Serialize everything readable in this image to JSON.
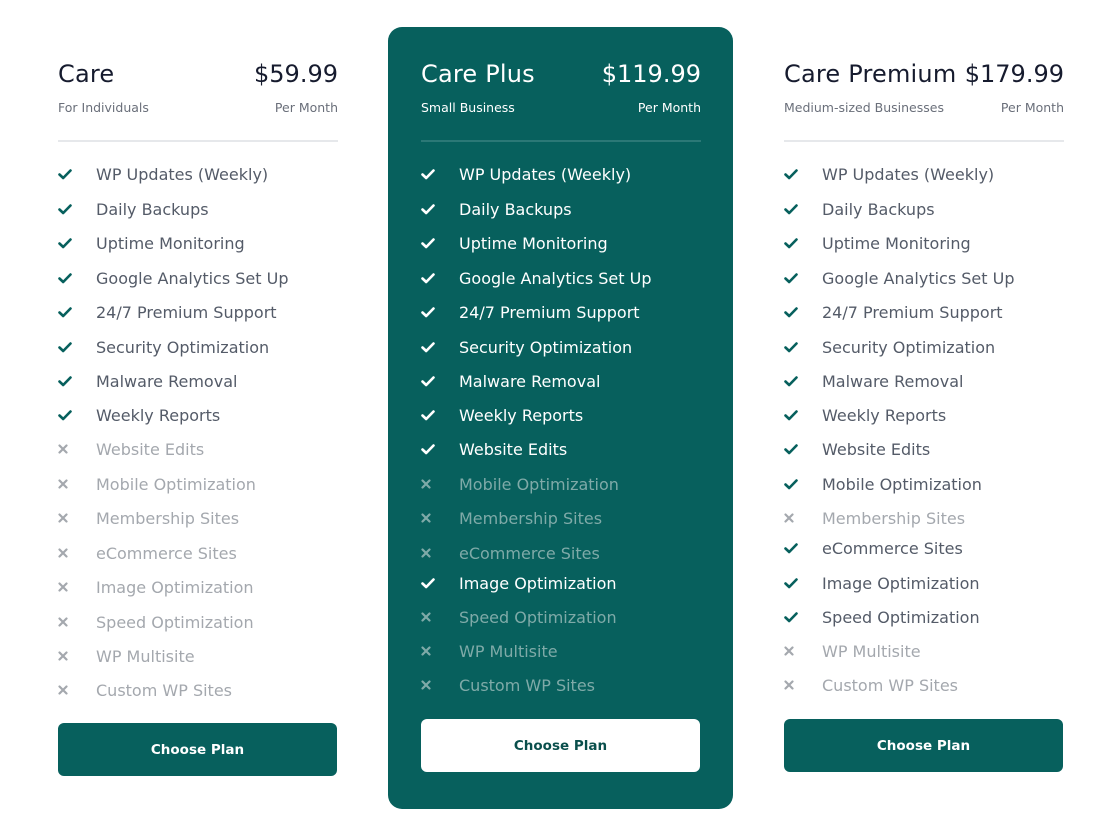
{
  "colors": {
    "brand": "#07605D",
    "text_dark": "#161B2E",
    "text_muted": "#6A6F7A",
    "feature_on": "#545B68",
    "feature_off": "#A4A8AE"
  },
  "plans": [
    {
      "title": "Care",
      "price": "$59.99",
      "audience": "For Individuals",
      "period": "Per Month",
      "cta": "Choose Plan",
      "features": [
        {
          "label": "WP Updates (Weekly)",
          "included": true,
          "icon": "check-icon"
        },
        {
          "label": "Daily Backups",
          "included": true,
          "icon": "check-icon"
        },
        {
          "label": "Uptime Monitoring",
          "included": true,
          "icon": "check-icon"
        },
        {
          "label": "Google Analytics Set Up",
          "included": true,
          "icon": "check-icon"
        },
        {
          "label": "24/7 Premium Support",
          "included": true,
          "icon": "check-icon"
        },
        {
          "label": "Security Optimization",
          "included": true,
          "icon": "check-icon"
        },
        {
          "label": "Malware Removal",
          "included": true,
          "icon": "check-icon"
        },
        {
          "label": "Weekly Reports",
          "included": true,
          "icon": "check-icon"
        },
        {
          "label": "Website Edits",
          "included": false,
          "icon": "x-icon"
        },
        {
          "label": "Mobile Optimization",
          "included": false,
          "icon": "x-icon"
        },
        {
          "label": "Membership Sites",
          "included": false,
          "icon": "x-icon"
        },
        {
          "label": "eCommerce Sites",
          "included": false,
          "icon": "x-icon"
        },
        {
          "label": "Image Optimization",
          "included": false,
          "icon": "x-icon"
        },
        {
          "label": "Speed Optimization",
          "included": false,
          "icon": "x-icon"
        },
        {
          "label": "WP Multisite",
          "included": false,
          "icon": "x-icon"
        },
        {
          "label": "Custom WP Sites",
          "included": false,
          "icon": "x-icon"
        }
      ]
    },
    {
      "title": "Care Plus",
      "price": "$119.99",
      "audience": "Small Business",
      "period": "Per Month",
      "cta": "Choose Plan",
      "featured": true,
      "features": [
        {
          "label": "WP Updates (Weekly)",
          "included": true,
          "icon": "check-icon"
        },
        {
          "label": "Daily Backups",
          "included": true,
          "icon": "check-icon"
        },
        {
          "label": "Uptime Monitoring",
          "included": true,
          "icon": "check-icon"
        },
        {
          "label": "Google Analytics Set Up",
          "included": true,
          "icon": "check-icon"
        },
        {
          "label": "24/7 Premium Support",
          "included": true,
          "icon": "check-icon"
        },
        {
          "label": "Security Optimization",
          "included": true,
          "icon": "check-icon"
        },
        {
          "label": "Malware Removal",
          "included": true,
          "icon": "check-icon"
        },
        {
          "label": "Weekly Reports",
          "included": true,
          "icon": "check-icon"
        },
        {
          "label": "Website Edits",
          "included": true,
          "icon": "check-icon"
        },
        {
          "label": "Mobile Optimization",
          "included": false,
          "icon": "x-icon"
        },
        {
          "label": "Membership Sites",
          "included": false,
          "icon": "x-icon"
        },
        {
          "label": "eCommerce Sites",
          "included": false,
          "icon": "x-icon"
        },
        {
          "label": "Image Optimization",
          "included": true,
          "icon": "check-icon"
        },
        {
          "label": "Speed Optimization",
          "included": false,
          "icon": "x-icon"
        },
        {
          "label": "WP Multisite",
          "included": false,
          "icon": "x-icon"
        },
        {
          "label": "Custom WP Sites",
          "included": false,
          "icon": "x-icon"
        }
      ]
    },
    {
      "title": "Care Premium",
      "price": "$179.99",
      "audience": "Medium-sized Businesses",
      "period": "Per Month",
      "cta": "Choose Plan",
      "features": [
        {
          "label": "WP Updates (Weekly)",
          "included": true,
          "icon": "check-icon"
        },
        {
          "label": "Daily Backups",
          "included": true,
          "icon": "check-icon"
        },
        {
          "label": "Uptime Monitoring",
          "included": true,
          "icon": "check-icon"
        },
        {
          "label": "Google Analytics Set Up",
          "included": true,
          "icon": "check-icon"
        },
        {
          "label": "24/7 Premium Support",
          "included": true,
          "icon": "check-icon"
        },
        {
          "label": "Security Optimization",
          "included": true,
          "icon": "check-icon"
        },
        {
          "label": "Malware Removal",
          "included": true,
          "icon": "check-icon"
        },
        {
          "label": "Weekly Reports",
          "included": true,
          "icon": "check-icon"
        },
        {
          "label": "Website Edits",
          "included": true,
          "icon": "check-icon"
        },
        {
          "label": "Mobile Optimization",
          "included": true,
          "icon": "check-icon"
        },
        {
          "label": "Membership Sites",
          "included": false,
          "icon": "x-icon"
        },
        {
          "label": "eCommerce Sites",
          "included": true,
          "icon": "check-icon"
        },
        {
          "label": "Image Optimization",
          "included": true,
          "icon": "check-icon"
        },
        {
          "label": "Speed Optimization",
          "included": true,
          "icon": "check-icon"
        },
        {
          "label": "WP Multisite",
          "included": false,
          "icon": "x-icon"
        },
        {
          "label": "Custom WP Sites",
          "included": false,
          "icon": "x-icon"
        }
      ]
    }
  ]
}
